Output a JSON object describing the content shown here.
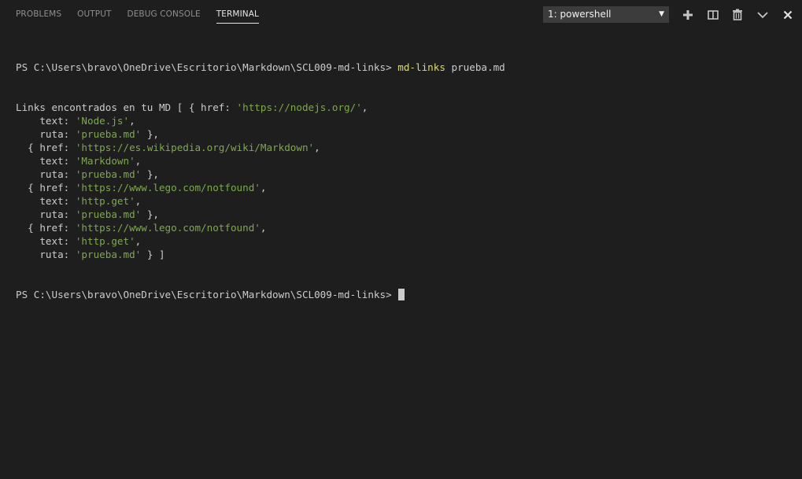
{
  "tabs": [
    {
      "label": "PROBLEMS",
      "active": false
    },
    {
      "label": "OUTPUT",
      "active": false
    },
    {
      "label": "DEBUG CONSOLE",
      "active": false
    },
    {
      "label": "TERMINAL",
      "active": true
    }
  ],
  "terminal_select": {
    "selected": "1: powershell",
    "caret": "▼"
  },
  "actions": [
    {
      "name": "new-terminal",
      "icon": "plus-icon"
    },
    {
      "name": "split-terminal",
      "icon": "split-icon"
    },
    {
      "name": "kill-terminal",
      "icon": "trash-icon"
    },
    {
      "name": "maximize-panel",
      "icon": "chevron-down-icon"
    },
    {
      "name": "close-panel",
      "icon": "close-icon"
    }
  ],
  "terminal": {
    "prompt": "PS C:\\Users\\bravo\\OneDrive\\Escritorio\\Markdown\\SCL009-md-links> ",
    "command": "md-links",
    "argument": " prueba.md",
    "output": [
      [
        {
          "t": "Links encontrados en tu MD [ { href: ",
          "c": "plain"
        },
        {
          "t": "'https://nodejs.org/'",
          "c": "str"
        },
        {
          "t": ",",
          "c": "plain"
        }
      ],
      [
        {
          "t": "    text: ",
          "c": "plain"
        },
        {
          "t": "'Node.js'",
          "c": "str"
        },
        {
          "t": ",",
          "c": "plain"
        }
      ],
      [
        {
          "t": "    ruta: ",
          "c": "plain"
        },
        {
          "t": "'prueba.md'",
          "c": "str"
        },
        {
          "t": " },",
          "c": "plain"
        }
      ],
      [
        {
          "t": "  { href: ",
          "c": "plain"
        },
        {
          "t": "'https://es.wikipedia.org/wiki/Markdown'",
          "c": "str"
        },
        {
          "t": ",",
          "c": "plain"
        }
      ],
      [
        {
          "t": "    text: ",
          "c": "plain"
        },
        {
          "t": "'Markdown'",
          "c": "str"
        },
        {
          "t": ",",
          "c": "plain"
        }
      ],
      [
        {
          "t": "    ruta: ",
          "c": "plain"
        },
        {
          "t": "'prueba.md'",
          "c": "str"
        },
        {
          "t": " },",
          "c": "plain"
        }
      ],
      [
        {
          "t": "  { href: ",
          "c": "plain"
        },
        {
          "t": "'https://www.lego.com/notfound'",
          "c": "str"
        },
        {
          "t": ",",
          "c": "plain"
        }
      ],
      [
        {
          "t": "    text: ",
          "c": "plain"
        },
        {
          "t": "'http.get'",
          "c": "str"
        },
        {
          "t": ",",
          "c": "plain"
        }
      ],
      [
        {
          "t": "    ruta: ",
          "c": "plain"
        },
        {
          "t": "'prueba.md'",
          "c": "str"
        },
        {
          "t": " },",
          "c": "plain"
        }
      ],
      [
        {
          "t": "  { href: ",
          "c": "plain"
        },
        {
          "t": "'https://www.lego.com/notfound'",
          "c": "str"
        },
        {
          "t": ",",
          "c": "plain"
        }
      ],
      [
        {
          "t": "    text: ",
          "c": "plain"
        },
        {
          "t": "'http.get'",
          "c": "str"
        },
        {
          "t": ",",
          "c": "plain"
        }
      ],
      [
        {
          "t": "    ruta: ",
          "c": "plain"
        },
        {
          "t": "'prueba.md'",
          "c": "str"
        },
        {
          "t": " } ]",
          "c": "plain"
        }
      ]
    ],
    "final_prompt": "PS C:\\Users\\bravo\\OneDrive\\Escritorio\\Markdown\\SCL009-md-links> "
  },
  "colors": {
    "background": "#1e1e1e",
    "text": "#cccccc",
    "command": "#dcdc6e",
    "string": "#7fa84c",
    "tab_inactive": "#8f8f8f",
    "tab_active": "#e7e7e7",
    "select_bg": "#3c3c3c"
  }
}
